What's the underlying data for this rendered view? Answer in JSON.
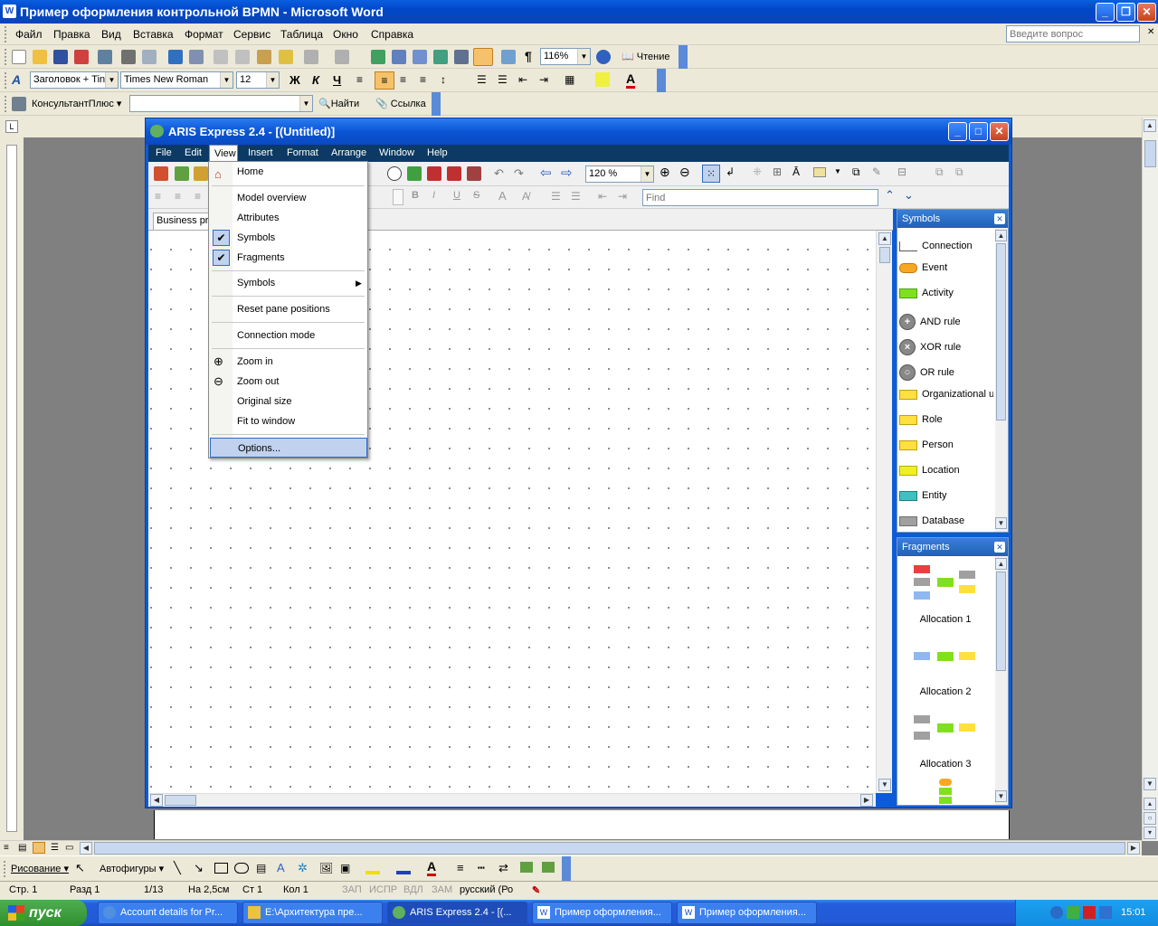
{
  "word": {
    "title": "Пример оформления контрольной BPMN - Microsoft Word",
    "menu": [
      "Файл",
      "Правка",
      "Вид",
      "Вставка",
      "Формат",
      "Сервис",
      "Таблица",
      "Окно",
      "Справка"
    ],
    "ask_placeholder": "Введите вопрос",
    "zoom": "116%",
    "reading_label": "Чтение",
    "style": "Заголовок + Tin",
    "font": "Times New Roman",
    "font_size": "12",
    "bold": "Ж",
    "italic": "К",
    "underline": "Ч",
    "consultant": "КонсультантПлюс",
    "find_label": "Найти",
    "link_label": "Ссылка",
    "draw_label": "Рисование",
    "autoshapes_label": "Автофигуры"
  },
  "aris": {
    "title": "ARIS Express 2.4 - [(Untitled)]",
    "menu": [
      "File",
      "Edit",
      "View",
      "Insert",
      "Format",
      "Arrange",
      "Window",
      "Help"
    ],
    "zoom": "120 %",
    "find_placeholder": "Find",
    "tab_label": "Business pro",
    "view_menu": {
      "home": "Home",
      "model_overview": "Model overview",
      "attributes": "Attributes",
      "symbols": "Symbols",
      "fragments": "Fragments",
      "symbols_sub": "Symbols",
      "reset": "Reset pane positions",
      "connection_mode": "Connection mode",
      "zoom_in": "Zoom in",
      "zoom_out": "Zoom out",
      "original_size": "Original size",
      "fit": "Fit to window",
      "options": "Options..."
    },
    "symbols_pane": {
      "title": "Symbols",
      "items": [
        "Connection",
        "Event",
        "Activity",
        "AND rule",
        "XOR rule",
        "OR rule",
        "Organizational ui",
        "Role",
        "Person",
        "Location",
        "Entity",
        "Database"
      ]
    },
    "fragments_pane": {
      "title": "Fragments",
      "items": [
        "Allocation 1",
        "Allocation 2",
        "Allocation 3"
      ]
    }
  },
  "status": {
    "page": "Стр. 1",
    "section": "Разд 1",
    "pages": "1/13",
    "at": "На 2,5см",
    "line": "Ст 1",
    "col": "Кол 1",
    "rec": "ЗАП",
    "trk": "ИСПР",
    "ext": "ВДЛ",
    "ovr": "ЗАМ",
    "lang": "русский (Ро"
  },
  "taskbar": {
    "start": "пуск",
    "tasks": [
      "Account details for Pr...",
      "E:\\Архитектура пре...",
      "ARIS Express 2.4 - [(...",
      "Пример оформления...",
      "Пример оформления..."
    ],
    "lang": "RU",
    "time": "15:01"
  },
  "colors": {
    "xp_blue": "#0a5fe0",
    "aris_menubar": "#0c3a64",
    "taskbar": "#245edb",
    "start_green": "#2f8f2f"
  }
}
